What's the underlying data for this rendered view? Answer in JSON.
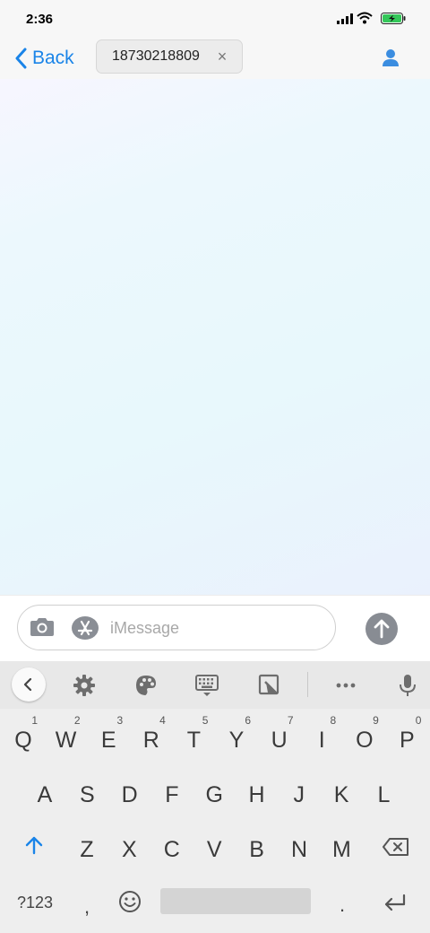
{
  "status_bar": {
    "time": "2:36"
  },
  "nav": {
    "back_label": "Back",
    "recipient": "18730218809",
    "remove_symbol": "×"
  },
  "composer": {
    "placeholder": "iMessage"
  },
  "keyboard": {
    "row1": [
      {
        "key": "Q",
        "hint": "1"
      },
      {
        "key": "W",
        "hint": "2"
      },
      {
        "key": "E",
        "hint": "3"
      },
      {
        "key": "R",
        "hint": "4"
      },
      {
        "key": "T",
        "hint": "5"
      },
      {
        "key": "Y",
        "hint": "6"
      },
      {
        "key": "U",
        "hint": "7"
      },
      {
        "key": "I",
        "hint": "8"
      },
      {
        "key": "O",
        "hint": "9"
      },
      {
        "key": "P",
        "hint": "0"
      }
    ],
    "row2": [
      "A",
      "S",
      "D",
      "F",
      "G",
      "H",
      "J",
      "K",
      "L"
    ],
    "row3": [
      "Z",
      "X",
      "C",
      "V",
      "B",
      "N",
      "M"
    ],
    "symbols_label": "?123",
    "comma": ",",
    "period": "."
  },
  "colors": {
    "accent": "#1a84e8",
    "send": "#888c93",
    "keyboard_bg": "#eeeeee"
  },
  "icons": [
    "signal-icon",
    "wifi-icon",
    "battery-icon",
    "chevron-left-icon",
    "contact-icon",
    "camera-icon",
    "app-store-icon",
    "send-arrow-icon",
    "settings-icon",
    "palette-icon",
    "keyboard-icon",
    "clipboard-icon",
    "more-icon",
    "mic-icon",
    "shift-icon",
    "backspace-icon",
    "emoji-icon",
    "enter-icon"
  ]
}
